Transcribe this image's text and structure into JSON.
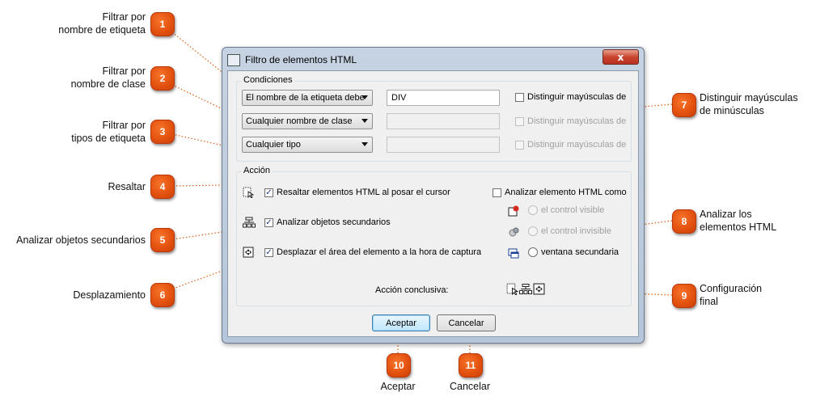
{
  "dialog": {
    "title": "Filtro de elementos HTML",
    "close_label": "x",
    "conditions": {
      "group_label": "Condiciones",
      "rows": [
        {
          "combo": "El nombre de la etiqueta debe",
          "value": "DIV",
          "check_label": "Distinguir mayúsculas de minúsculas",
          "enabled": true
        },
        {
          "combo": "Cualquier nombre de clase",
          "value": "",
          "check_label": "Distinguir mayúsculas de minúsculas",
          "enabled": false
        },
        {
          "combo": "Cualquier tipo",
          "value": "",
          "check_label": "Distinguir mayúsculas de minúsculas",
          "enabled": false
        }
      ]
    },
    "action": {
      "group_label": "Acción",
      "highlight_label": "Resaltar elementos HTML al posar el cursor",
      "highlight_checked": true,
      "analyze_children_label": "Analizar objetos secundarios",
      "analyze_children_checked": true,
      "scroll_label": "Desplazar el área del elemento a la hora de capturar la imagen",
      "scroll_checked": true,
      "analyze_as_label": "Analizar elemento HTML como",
      "analyze_as_checked": false,
      "radio_visible": "el control visible",
      "radio_invisible": "el control invisible",
      "radio_window": "ventana secundaria",
      "final_action_label": "Acción conclusiva:"
    },
    "ok_label": "Aceptar",
    "cancel_label": "Cancelar"
  },
  "callouts": [
    {
      "num": "1",
      "text_line1": "Filtrar por",
      "text_line2": "nombre de etiqueta"
    },
    {
      "num": "2",
      "text_line1": "Filtrar por",
      "text_line2": "nombre de clase"
    },
    {
      "num": "3",
      "text_line1": "Filtrar por",
      "text_line2": "tipos de etiqueta"
    },
    {
      "num": "4",
      "text_line1": "Resaltar"
    },
    {
      "num": "5",
      "text_line1": "Analizar objetos secundarios"
    },
    {
      "num": "6",
      "text_line1": "Desplazamiento"
    },
    {
      "num": "7",
      "text_line1": "Distinguir mayúsculas",
      "text_line2": "de minúsculas"
    },
    {
      "num": "8",
      "text_line1": "Analizar los",
      "text_line2": "elementos HTML"
    },
    {
      "num": "9",
      "text_line1": "Configuración",
      "text_line2": "final"
    },
    {
      "num": "10",
      "text_line1": "Aceptar"
    },
    {
      "num": "11",
      "text_line1": "Cancelar"
    }
  ],
  "colors": {
    "badge": "#e2500e",
    "leader": "#e05a10",
    "dot": "#f2a21b"
  }
}
